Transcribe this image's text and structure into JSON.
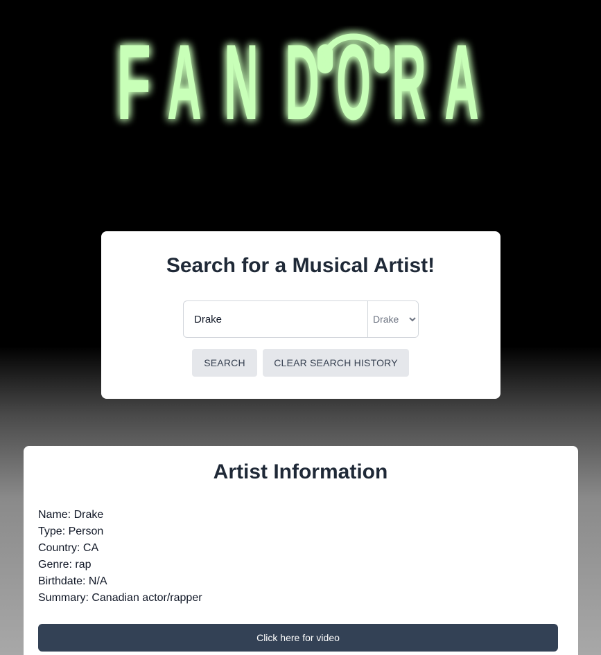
{
  "logo": {
    "letters": [
      "F",
      "A",
      "N",
      "D",
      "O",
      "R",
      "A"
    ],
    "glow_color": "#39ff14",
    "fill_color": "#c8ffb8"
  },
  "search": {
    "title": "Search for a Musical Artist!",
    "input_value": "Drake",
    "select_value": "Drake",
    "select_options": [
      "Drake"
    ],
    "search_label": "SEARCH",
    "clear_label": "CLEAR SEARCH HISTORY"
  },
  "artist": {
    "heading": "Artist Information",
    "fields": [
      "Name: Drake",
      "Type: Person",
      "Country: CA",
      "Genre: rap",
      "Birthdate: N/A",
      "Summary: Canadian actor/rapper"
    ],
    "video_label": "Click here for video"
  },
  "colors": {
    "card_bg": "#ffffff",
    "button_bg": "#e5e7eb",
    "video_button_bg": "#334155",
    "heading_text": "#1f2937"
  }
}
